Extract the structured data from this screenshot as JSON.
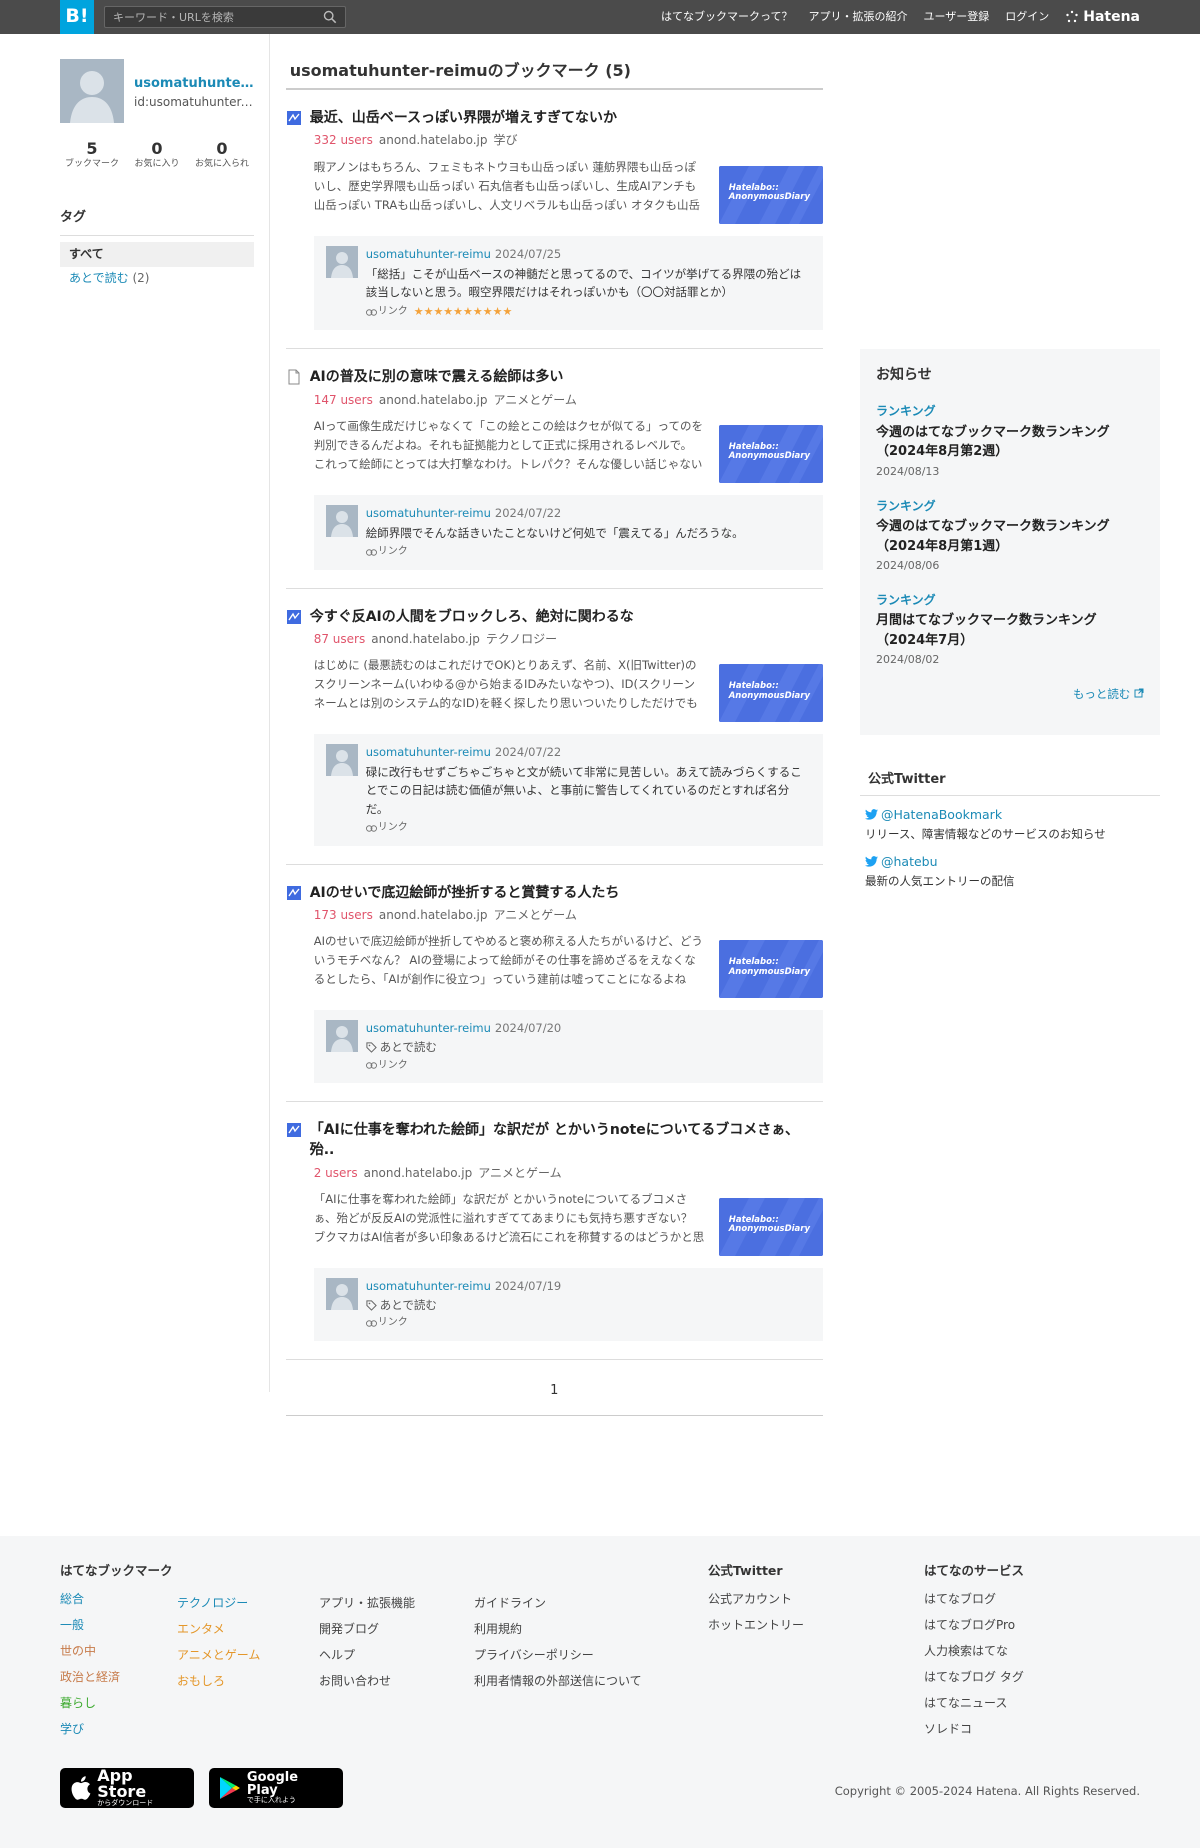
{
  "header": {
    "logo": "B!",
    "search_placeholder": "キーワード・URLを検索",
    "nav": [
      "はてなブックマークって？",
      "アプリ・拡張の紹介",
      "ユーザー登録",
      "ログイン"
    ],
    "brand": "Hatena"
  },
  "profile": {
    "name": "usomatuhunter-reimu",
    "id": "id:usomatuhunter-reimu",
    "stats": [
      {
        "num": "5",
        "label": "ブックマーク"
      },
      {
        "num": "0",
        "label": "お気に入り"
      },
      {
        "num": "0",
        "label": "お気に入られ"
      }
    ]
  },
  "tags": {
    "heading": "タグ",
    "all_label": "すべて",
    "items": [
      {
        "label": "あとで読む",
        "count": "(2)"
      }
    ]
  },
  "main": {
    "title": "usomatuhunter-reimuのブックマーク (5)",
    "entries": [
      {
        "title": "最近、山岳ベースっぽい界隈が増えすぎてないか",
        "users": "332 users",
        "domain": "anond.hatelabo.jp",
        "category": "学び",
        "summary": "暇アノンはもちろん、フェミもネトウヨも山岳っぽい 蓮舫界隈も山岳っぽいし、歴史学界隈も山岳っぽい 石丸信者も山岳っぽいし、生成AIアンチも山岳っぽい TRAも山岳っぽいし、人文リベラルも山岳っぽい オタクも山岳っぽい",
        "comment_user": "usomatuhunter-reimu",
        "comment_date": "2024/07/25",
        "comment_text": "「総括」こそが山岳ベースの神髄だと思ってるので、コイツが挙げてる界隈の殆どは該当しないと思う。暇空界隈だけはそれっぽいかも（〇〇対話罪とか）",
        "comment_tag": "",
        "link_label": "リンク",
        "stars": "★★★★★★★★★★"
      },
      {
        "title": "AIの普及に別の意味で震える絵師は多い",
        "users": "147 users",
        "domain": "anond.hatelabo.jp",
        "category": "アニメとゲーム",
        "summary": "AIって画像生成だけじゃなくて「この絵とこの絵はクセが似てる」ってのを判別できるんだよね。それも証拠能力として正式に採用されるレベルで。 これって絵師にとっては大打撃なわけ。トレパク？そんな優しい話じゃない",
        "comment_user": "usomatuhunter-reimu",
        "comment_date": "2024/07/22",
        "comment_text": "絵師界隈でそんな話きいたことないけど何処で「震えてる」んだろうな。",
        "comment_tag": "",
        "link_label": "リンク",
        "stars": ""
      },
      {
        "title": "今すぐ反AIの人間をブロックしろ、絶対に関わるな",
        "users": "87 users",
        "domain": "anond.hatelabo.jp",
        "category": "テクノロジー",
        "summary": "はじめに (最悪読むのはこれだけでOK)とりあえず、名前、X(旧Twitter)のスクリーンネーム(いわゆる@から始まるIDみたいなやつ)、ID(スクリーンネームとは別のシステム的なID)を軽く探したり思いついたりしただけでも",
        "comment_user": "usomatuhunter-reimu",
        "comment_date": "2024/07/22",
        "comment_text": "碌に改行もせずごちゃごちゃと文が続いて非常に見苦しい。あえて読みづらくすることでこの日記は読む価値が無いよ、と事前に警告してくれているのだとすれば名分だ。",
        "comment_tag": "",
        "link_label": "リンク",
        "stars": ""
      },
      {
        "title": "AIのせいで底辺絵師が挫折すると賞賛する人たち",
        "users": "173 users",
        "domain": "anond.hatelabo.jp",
        "category": "アニメとゲーム",
        "summary": "AIのせいで底辺絵師が挫折してやめると褒め称える人たちがいるけど、どういうモチベなん？ AIの登場によって絵師がその仕事を諦めざるをえなくなるとしたら、「AIが創作に役立つ」っていう建前は嘘ってことになるよね",
        "comment_user": "usomatuhunter-reimu",
        "comment_date": "2024/07/20",
        "comment_text": "",
        "comment_tag": "あとで読む",
        "link_label": "リンク",
        "stars": ""
      },
      {
        "title": "「AIに仕事を奪われた絵師」な訳だが とかいうnoteについてるブコメさぁ、殆..",
        "users": "2 users",
        "domain": "anond.hatelabo.jp",
        "category": "アニメとゲーム",
        "summary": "「AIに仕事を奪われた絵師」な訳だが とかいうnoteについてるブコメさぁ、殆どが反反AIの党派性に溢れすぎててあまりにも気持ち悪すぎない？ ブクマカはAI信者が多い印象あるけど流石にこれを称賛するのはどうかと思う",
        "comment_user": "usomatuhunter-reimu",
        "comment_date": "2024/07/19",
        "comment_text": "",
        "comment_tag": "あとで読む",
        "link_label": "リンク",
        "stars": ""
      }
    ],
    "thumb_text_1": "Hatelabo::",
    "thumb_text_2": "AnonymousDiary",
    "page": "1"
  },
  "notice": {
    "heading": "お知らせ",
    "items": [
      {
        "cat": "ランキング",
        "title": "今週のはてなブックマーク数ランキング（2024年8月第2週）",
        "date": "2024/08/13"
      },
      {
        "cat": "ランキング",
        "title": "今週のはてなブックマーク数ランキング（2024年8月第1週）",
        "date": "2024/08/06"
      },
      {
        "cat": "ランキング",
        "title": "月間はてなブックマーク数ランキング（2024年7月）",
        "date": "2024/08/02"
      }
    ],
    "more": "もっと読む"
  },
  "twitter": {
    "heading": "公式Twitter",
    "items": [
      {
        "handle": "@HatenaBookmark",
        "desc": "リリース、障害情報などのサービスのお知らせ"
      },
      {
        "handle": "@hatebu",
        "desc": "最新の人気エントリーの配信"
      }
    ]
  },
  "footer": {
    "col1_heading": "はてなブックマーク",
    "categories_a": [
      "総合",
      "一般",
      "世の中",
      "政治と経済",
      "暮らし",
      "学び"
    ],
    "categories_b": [
      "テクノロジー",
      "エンタメ",
      "アニメとゲーム",
      "おもしろ"
    ],
    "links_c": [
      "アプリ・拡張機能",
      "開発ブログ",
      "ヘルプ",
      "お問い合わせ"
    ],
    "links_d": [
      "ガイドライン",
      "利用規約",
      "プライバシーポリシー",
      "利用者情報の外部送信について"
    ],
    "col_twitter_heading": "公式Twitter",
    "twitter_links": [
      "公式アカウント",
      "ホットエントリー"
    ],
    "col_services_heading": "はてなのサービス",
    "services": [
      "はてなブログ",
      "はてなブログPro",
      "人力検索はてな",
      "はてなブログ タグ",
      "はてなニュース",
      "ソレドコ"
    ],
    "app_store_big": "App Store",
    "app_store_small": "からダウンロード",
    "google_play_big": "Google Play",
    "google_play_small": "で手に入れよう",
    "copyright": "Copyright © 2005-2024 Hatena. All Rights Reserved."
  }
}
